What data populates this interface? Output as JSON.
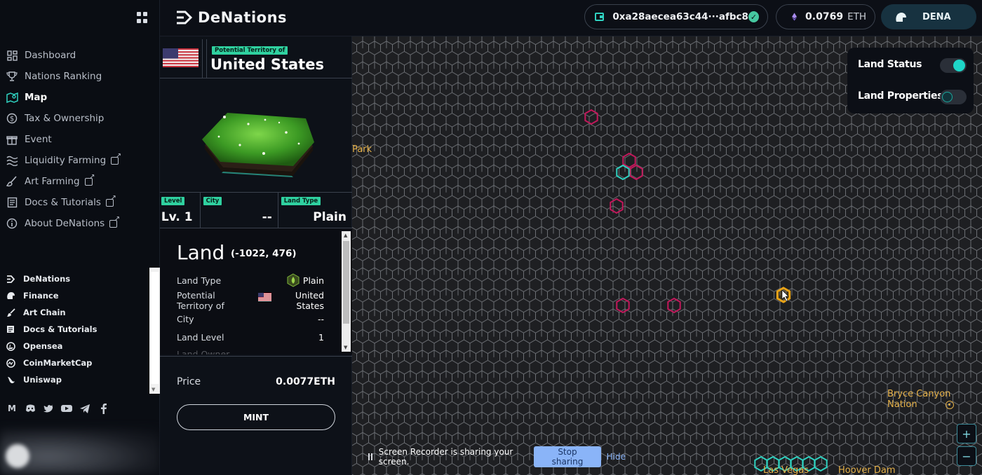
{
  "app": {
    "logo_text": "DeNations"
  },
  "header": {
    "wallet_address": "0xa28aecea63c44···afbc8",
    "eth_balance": "0.0769",
    "eth_unit": "ETH",
    "token_label": "DENA"
  },
  "sidebar": {
    "nav_items": [
      {
        "label": "Dashboard",
        "icon": "dashboard-icon",
        "active": false,
        "external": false
      },
      {
        "label": "Nations Ranking",
        "icon": "trophy-icon",
        "active": false,
        "external": false
      },
      {
        "label": "Map",
        "icon": "map-icon",
        "active": true,
        "external": false
      },
      {
        "label": "Tax & Ownership",
        "icon": "dollar-icon",
        "active": false,
        "external": false
      },
      {
        "label": "Event",
        "icon": "gift-icon",
        "active": false,
        "external": false
      },
      {
        "label": "Liquidity Farming",
        "icon": "waves-icon",
        "active": false,
        "external": true
      },
      {
        "label": "Art Farming",
        "icon": "brush-icon",
        "active": false,
        "external": true
      },
      {
        "label": "Docs & Tutorials",
        "icon": "document-icon",
        "active": false,
        "external": true
      },
      {
        "label": "About DeNations",
        "icon": "info-icon",
        "active": false,
        "external": true
      }
    ],
    "links": [
      {
        "label": "DeNations",
        "icon": "denations-icon"
      },
      {
        "label": "Finance",
        "icon": "finance-icon"
      },
      {
        "label": "Art Chain",
        "icon": "brush-icon"
      },
      {
        "label": "Docs & Tutorials",
        "icon": "document-icon"
      },
      {
        "label": "Opensea",
        "icon": "opensea-icon"
      },
      {
        "label": "CoinMarketCap",
        "icon": "coinmarketcap-icon"
      },
      {
        "label": "Uniswap",
        "icon": "uniswap-icon"
      }
    ],
    "social": [
      "medium-icon",
      "discord-icon",
      "twitter-icon",
      "youtube-icon",
      "telegram-icon",
      "facebook-icon"
    ]
  },
  "panel": {
    "territory_tag": "Potential Territory of",
    "territory_name": "United States",
    "stats": [
      {
        "tag": "Level",
        "value": "Lv. 1"
      },
      {
        "tag": "City",
        "value": "--"
      },
      {
        "tag": "Land Type",
        "value": "Plain"
      }
    ],
    "land_title": "Land",
    "land_coords": "(-1022, 476)",
    "details": [
      {
        "key": "Land Type",
        "value": "Plain"
      },
      {
        "key": "Potential Territory of",
        "value": "United States"
      },
      {
        "key": "City",
        "value": "--"
      },
      {
        "key": "Land Level",
        "value": "1"
      },
      {
        "key": "Land Owner",
        "value": ""
      }
    ],
    "price_label": "Price",
    "price_value": "0.0077ETH",
    "mint_label": "MINT"
  },
  "map": {
    "toggles": [
      {
        "label": "Land Status",
        "on": true
      },
      {
        "label": "Land Properties",
        "on": false
      }
    ],
    "labels": {
      "park": "Park",
      "bryce": "Bryce Canyon Nation",
      "vegas": "Las Vegas",
      "hoover": "Hoover Dam"
    },
    "zoom_in": "+",
    "zoom_out": "−"
  },
  "screen_share": {
    "message": "Screen Recorder is sharing your screen.",
    "stop_label": "Stop sharing",
    "hide_label": "Hide"
  },
  "colors": {
    "accent": "#2fd1c0",
    "owned_hex": "#c2185b",
    "selected_hex": "#e8a317",
    "tag_green": "#2fd1a0"
  }
}
